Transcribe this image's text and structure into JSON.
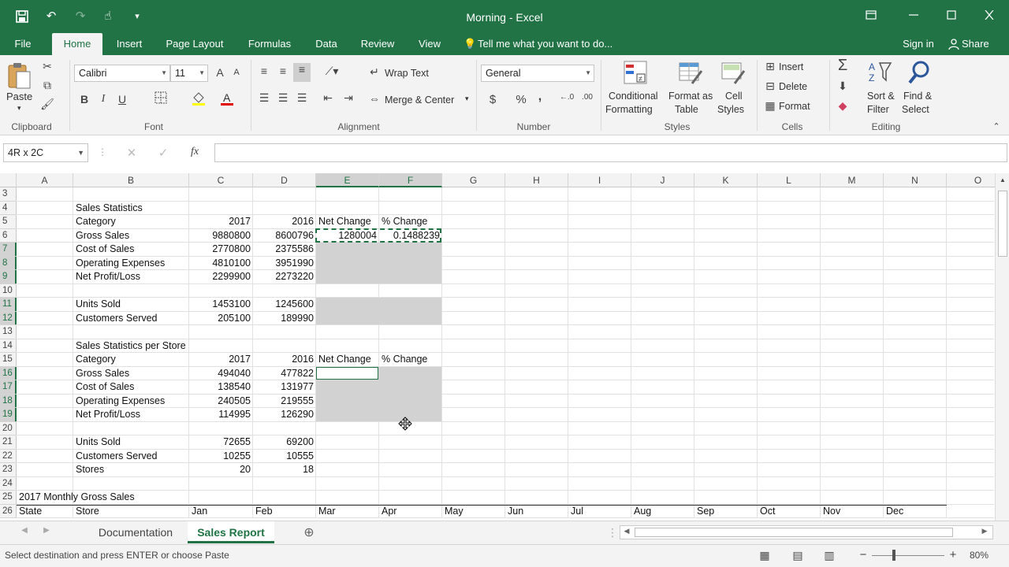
{
  "window": {
    "title": "Morning - Excel",
    "accent": "#217346",
    "qat_undo": "↶",
    "qat_redo": "↷",
    "qat_touch": "☝",
    "qat_customize": "▾"
  },
  "ribbon": {
    "tabs": [
      "File",
      "Home",
      "Insert",
      "Page Layout",
      "Formulas",
      "Data",
      "Review",
      "View"
    ],
    "active_tab": "Home",
    "tell_me": "Tell me what you want to do...",
    "sign_in": "Sign in",
    "share": "Share",
    "clipboard": {
      "paste": "Paste",
      "label": "Clipboard"
    },
    "font": {
      "name": "Calibri",
      "size": "11",
      "bold": "B",
      "italic": "I",
      "underline": "U",
      "label": "Font",
      "grow": "A",
      "shrink": "A"
    },
    "alignment": {
      "wrap_text": "Wrap Text",
      "merge_center": "Merge & Center",
      "label": "Alignment"
    },
    "number": {
      "format": "General",
      "currency": "$",
      "percent": "%",
      "comma": ",",
      "inc_dec": "←.0\n.00",
      "dec_dec": ".00\n→.0",
      "label": "Number"
    },
    "styles": {
      "conditional_1": "Conditional",
      "conditional_2": "Formatting",
      "format_table_1": "Format as",
      "format_table_2": "Table",
      "cell_styles_1": "Cell",
      "cell_styles_2": "Styles",
      "label": "Styles"
    },
    "cells": {
      "insert": "Insert",
      "delete": "Delete",
      "format": "Format",
      "label": "Cells"
    },
    "editing": {
      "sort_1": "Sort &",
      "sort_2": "Filter",
      "find_1": "Find &",
      "find_2": "Select",
      "label": "Editing",
      "sigma": "Σ"
    }
  },
  "formula_bar": {
    "name_box": "4R x 2C",
    "fx": "fx",
    "value": ""
  },
  "columns": [
    "A",
    "B",
    "C",
    "D",
    "E",
    "F",
    "G",
    "H",
    "I",
    "J",
    "K",
    "L",
    "M",
    "N",
    "O"
  ],
  "rows": [
    "3",
    "4",
    "5",
    "6",
    "7",
    "8",
    "9",
    "10",
    "11",
    "12",
    "13",
    "14",
    "15",
    "16",
    "17",
    "18",
    "19",
    "20",
    "21",
    "22",
    "23",
    "24",
    "25",
    "26"
  ],
  "cells": {
    "B4": "Sales Statistics",
    "B5": "Category",
    "C5": "2017",
    "D5": "2016",
    "E5": "Net Change",
    "F5": "% Change",
    "B6": "Gross Sales",
    "C6": "9880800",
    "D6": "8600796",
    "E6": "1280004",
    "F6": "0.1488239",
    "B7": "Cost of Sales",
    "C7": "2770800",
    "D7": "2375586",
    "B8": "Operating Expenses",
    "C8": "4810100",
    "D8": "3951990",
    "B9": "Net Profit/Loss",
    "C9": "2299900",
    "D9": "2273220",
    "B11": "Units Sold",
    "C11": "1453100",
    "D11": "1245600",
    "B12": "Customers Served",
    "C12": "205100",
    "D12": "189990",
    "B14": "Sales Statistics per Store",
    "B15": "Category",
    "C15": "2017",
    "D15": "2016",
    "E15": "Net Change",
    "F15": "% Change",
    "B16": "Gross Sales",
    "C16": "494040",
    "D16": "477822",
    "B17": "Cost of Sales",
    "C17": "138540",
    "D17": "131977",
    "B18": "Operating Expenses",
    "C18": "240505",
    "D18": "219555",
    "B19": "Net Profit/Loss",
    "C19": "114995",
    "D19": "126290",
    "B21": "Units Sold",
    "C21": "72655",
    "D21": "69200",
    "B22": "Customers Served",
    "C22": "10255",
    "D22": "10555",
    "B23": "Stores",
    "C23": "20",
    "D23": "18",
    "A25": "2017 Monthly Gross Sales",
    "A26": "State",
    "B26": "Store",
    "C26": "Jan",
    "D26": "Feb",
    "E26": "Mar",
    "F26": "Apr",
    "G26": "May",
    "H26": "Jun",
    "I26": "Jul",
    "J26": "Aug",
    "K26": "Sep",
    "L26": "Oct",
    "M26": "Nov",
    "N26": "Dec"
  },
  "sheets": {
    "tabs": [
      "Documentation",
      "Sales Report"
    ],
    "active": "Sales Report",
    "add": "⊕"
  },
  "status": {
    "message": "Select destination and press ENTER or choose Paste",
    "zoom": "80%",
    "zoom_minus": "−",
    "zoom_plus": "+"
  }
}
